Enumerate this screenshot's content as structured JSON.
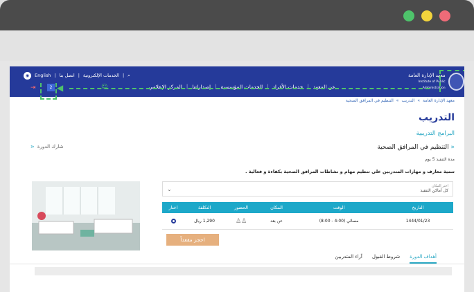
{
  "window": {
    "dot_colors": [
      "#4ec36b",
      "#f2d43c",
      "#ef6b78"
    ]
  },
  "site": {
    "logo_text": "معهد الإدارة العامة",
    "logo_subtext": "Institute of Public Administration",
    "nav": [
      "عن المعهد",
      "خدمات الأفراد",
      "الخدمات المؤسسية",
      "إصداراتنا",
      "المركز الإعلامي"
    ],
    "util": {
      "electronic_services": "الخدمات الإلكترونية",
      "contact": "اتصل بنا",
      "english": "English",
      "search_icon": "search-icon"
    },
    "badge_number": "2"
  },
  "breadcrumb": [
    "معهد الإدارة العامة",
    "التدريب",
    "التنظيم في المرافق الصحية"
  ],
  "page_title": "التدريب",
  "subtitle": "البرامج التدريبية",
  "course_title": "التنظيم في المرافق الصحية",
  "share_label": "شارك الدورة",
  "duration": "مدة التنفيذ 5 يوم",
  "description": "تنمية معارف و مهارات المتدربين على تنظيم مهام و نشاطات المرافق الصحية بكفاءة و فعالية .",
  "location_select": {
    "label": "اختر المكان",
    "value": "كل أماكن التنفيذ"
  },
  "table": {
    "headers": [
      "التاريخ",
      "الوقت",
      "المكان",
      "الحضور",
      "التكلفة",
      "اختار"
    ],
    "rows": [
      {
        "date": "1444/01/23",
        "time": "مسائي (4:00 - 8:00)",
        "place": "عن بعد",
        "cost": "1,290 ريال"
      }
    ]
  },
  "book_button": "احجز مقعداً",
  "tabs": [
    "أهداف الدورة",
    "شروط القبول",
    "آراء المتدربين"
  ],
  "colors": {
    "header_blue": "#253a9a",
    "table_teal": "#1da8c9",
    "accent_cyan": "#2aa8c4",
    "book_orange": "#e6b07e",
    "annotation_green": "#4ec36b"
  }
}
